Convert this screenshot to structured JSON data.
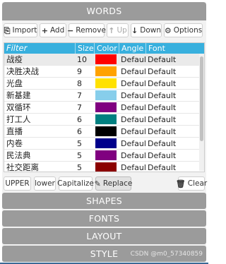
{
  "panel_title": "WORDS",
  "toolbar": {
    "import_label": "Import",
    "add_label": "Add",
    "remove_label": "Remove",
    "up_label": "Up",
    "down_label": "Down",
    "options_label": "Options"
  },
  "table": {
    "filter_placeholder": "Filter",
    "headers": {
      "size": "Size",
      "color": "Color",
      "angle": "Angle",
      "font": "Font"
    },
    "rows": [
      {
        "word": "战疫",
        "size": "10",
        "color": "#ff0000",
        "angle": "Default",
        "font": "Default",
        "selected": true
      },
      {
        "word": "决胜决战",
        "size": "9",
        "color": "#ffa200",
        "angle": "Default",
        "font": "Default"
      },
      {
        "word": "光盘",
        "size": "8",
        "color": "#ffe100",
        "angle": "Default",
        "font": "Default"
      },
      {
        "word": "新基建",
        "size": "7",
        "color": "#87ceeb",
        "angle": "Default",
        "font": "Default"
      },
      {
        "word": "双循环",
        "size": "7",
        "color": "#800080",
        "angle": "Default",
        "font": "Default"
      },
      {
        "word": "打工人",
        "size": "6",
        "color": "#008080",
        "angle": "Default",
        "font": "Default"
      },
      {
        "word": "直播",
        "size": "6",
        "color": "#000000",
        "angle": "Default",
        "font": "Default"
      },
      {
        "word": "内卷",
        "size": "5",
        "color": "#00008b",
        "angle": "Default",
        "font": "Default"
      },
      {
        "word": "民法典",
        "size": "5",
        "color": "#800080",
        "angle": "Default",
        "font": "Default"
      },
      {
        "word": "社交距离",
        "size": "5",
        "color": "#8b0000",
        "angle": "Default",
        "font": "Default"
      }
    ]
  },
  "actions": {
    "upper_label": "UPPER",
    "lower_label": "lower",
    "capitalize_label": "Capitalize",
    "replace_label": "Replace",
    "clear_label": "Clear"
  },
  "sections": [
    "SHAPES",
    "FONTS",
    "LAYOUT",
    "STYLE"
  ],
  "watermark": "CSDN @m0_57340859"
}
